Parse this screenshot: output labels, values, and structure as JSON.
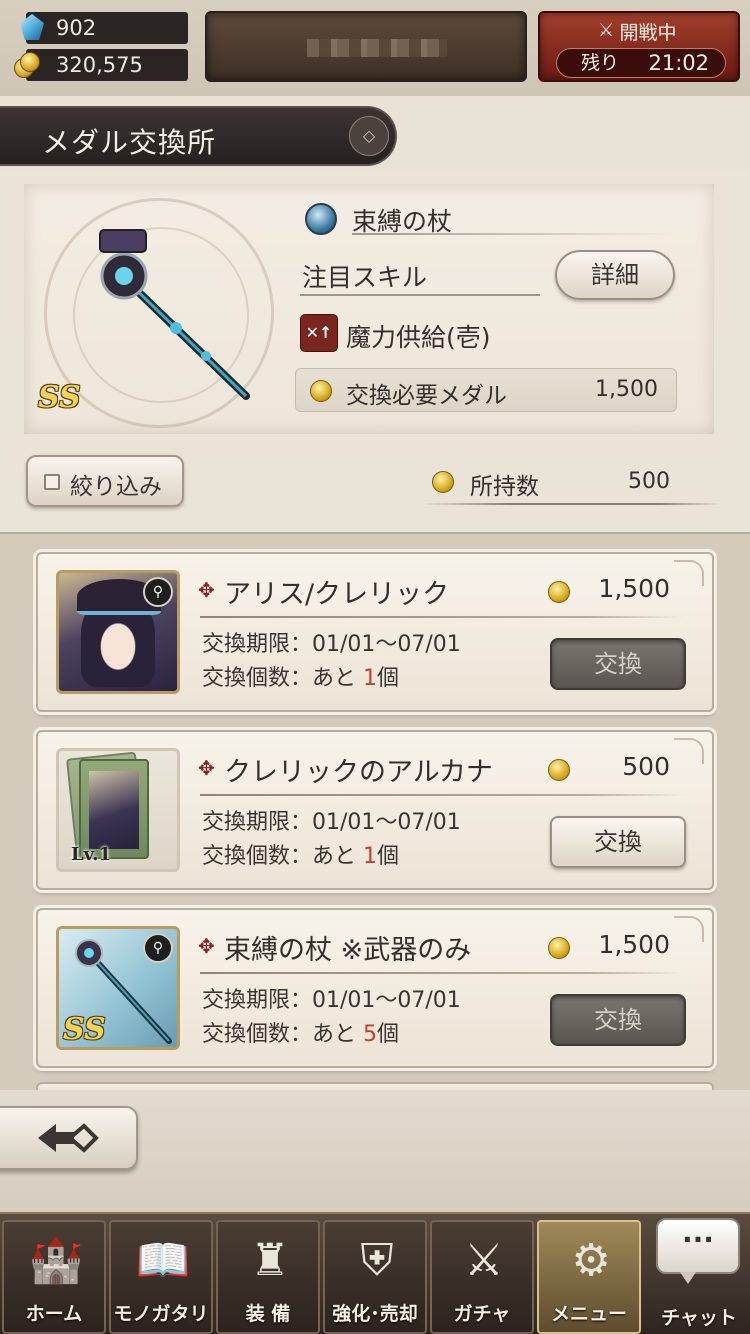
{
  "header": {
    "gems": "902",
    "coins": "320,575",
    "battle_status": "開戦中",
    "battle_remaining_label": "残り",
    "battle_time": "21:02"
  },
  "page": {
    "title": "メダル交換所"
  },
  "preview": {
    "name": "束縛の杖",
    "rarity": "SS",
    "featured_skill_label": "注目スキル",
    "detail_button": "詳細",
    "skill_icon_text": "✕↑",
    "skill_name": "魔力供給(壱)",
    "medal_cost_label": "交換必要メダル",
    "medal_cost_value": "1,500"
  },
  "filter": {
    "label": "絞り込み"
  },
  "owned": {
    "label": "所持数",
    "value": "500"
  },
  "items": [
    {
      "title": "アリス/クレリック",
      "cost": "1,500",
      "period": "交換期限：01/01〜07/01",
      "count_prefix": "交換個数：あと",
      "count": "1",
      "count_suffix": "個",
      "button": "交換",
      "button_state": "disabled"
    },
    {
      "title": "クレリックのアルカナ",
      "cost": "500",
      "period": "交換期限：01/01〜07/01",
      "count_prefix": "交換個数：あと",
      "count": "1",
      "count_suffix": "個",
      "button": "交換",
      "button_state": "enabled",
      "thumb_label": "Lv.1"
    },
    {
      "title": "束縛の杖 ※武器のみ",
      "cost": "1,500",
      "period": "交換期限：01/01〜07/01",
      "count_prefix": "交換個数：あと",
      "count": "5",
      "count_suffix": "個",
      "button": "交換",
      "button_state": "disabled",
      "thumb_label": "SS"
    }
  ],
  "nav": {
    "tabs": [
      {
        "label": "ホーム",
        "icon": "castle-icon"
      },
      {
        "label": "モノガタリ",
        "icon": "book-icon"
      },
      {
        "label": "装 備",
        "icon": "mannequin-icon"
      },
      {
        "label": "強化･売却",
        "icon": "helmet-icon"
      },
      {
        "label": "ガチャ",
        "icon": "crossed-swords-icon"
      },
      {
        "label": "メニュー",
        "icon": "gears-icon"
      }
    ],
    "chat_label": "チャット",
    "chat_bubble": "···",
    "active_tab": "メニュー"
  },
  "colors": {
    "accent_red": "#c8402a",
    "battle_panel": "#8a2a1c"
  }
}
